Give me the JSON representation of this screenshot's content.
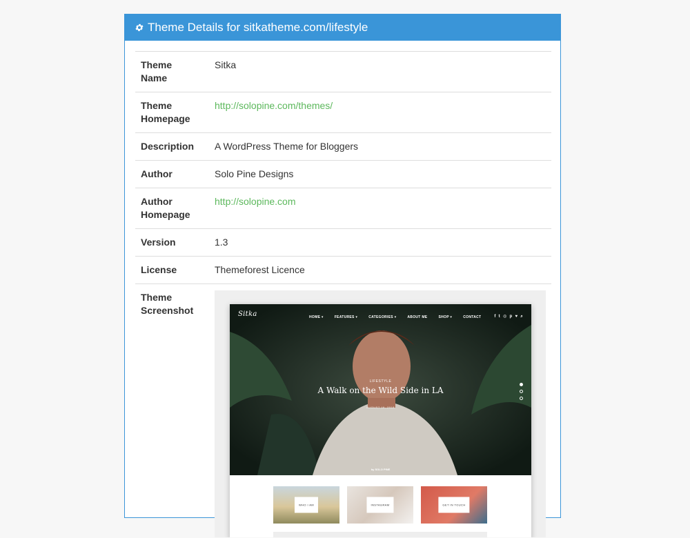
{
  "panel": {
    "title": "Theme Details for sitkatheme.com/lifestyle",
    "header_color": "#3a95d8",
    "icon": "gear-icon"
  },
  "details": [
    {
      "label": "Theme Name",
      "value": "Sitka",
      "link": false
    },
    {
      "label": "Theme Homepage",
      "value": "http://solopine.com/themes/",
      "link": true
    },
    {
      "label": "Description",
      "value": "A WordPress Theme for Bloggers",
      "link": false
    },
    {
      "label": "Author",
      "value": "Solo Pine Designs",
      "link": false
    },
    {
      "label": "Author Homepage",
      "value": "http://solopine.com",
      "link": true
    },
    {
      "label": "Version",
      "value": "1.3",
      "link": false
    },
    {
      "label": "License",
      "value": "Themeforest Licence",
      "link": false
    }
  ],
  "screenshot": {
    "label": "Theme Screenshot",
    "logo": "Sitka",
    "menu": [
      "HOME ▾",
      "FEATURES ▾",
      "CATEGORIES ▾",
      "ABOUT ME",
      "SHOP ▾",
      "CONTACT"
    ],
    "social": [
      "f",
      "t",
      "◎",
      "p",
      "♥",
      "⌕"
    ],
    "category": "LIFESTYLE",
    "post_title": "A Walk on the Wild Side in LA",
    "date": "AUGUST 16, 2018",
    "author": "by SOLO PINE",
    "promos": [
      "WHO I AM",
      "INSTAGRAM",
      "GET IN TOUCH"
    ]
  },
  "link_color": "#5cb85c"
}
